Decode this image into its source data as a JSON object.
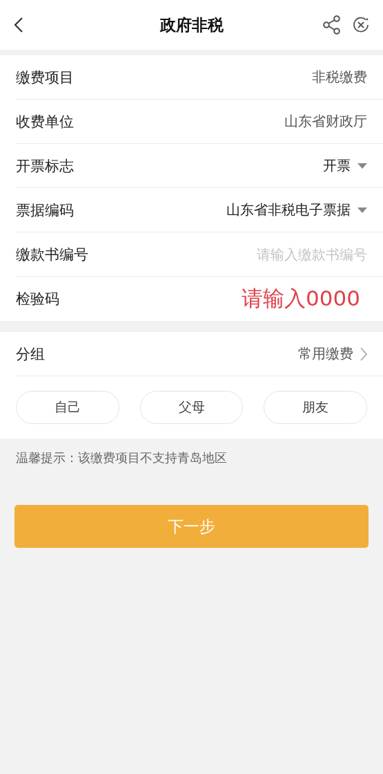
{
  "nav": {
    "title": "政府非税"
  },
  "fields": [
    {
      "kind": "value",
      "label": "缴费项目",
      "value": "非税缴费"
    },
    {
      "kind": "value",
      "label": "收费单位",
      "value": "山东省财政厅"
    },
    {
      "kind": "dropdown",
      "label": "开票标志",
      "value": "开票"
    },
    {
      "kind": "dropdown",
      "label": "票据编码",
      "value": "山东省非税电子票据"
    },
    {
      "kind": "input",
      "label": "缴款书编号",
      "placeholder": "请输入缴款书编号"
    },
    {
      "kind": "annotated",
      "label": "检验码",
      "annotation": "请输入0000"
    }
  ],
  "group": {
    "label": "分组",
    "value": "常用缴费"
  },
  "chips": [
    {
      "label": "自己"
    },
    {
      "label": "父母"
    },
    {
      "label": "朋友"
    }
  ],
  "tip": "温馨提示：该缴费项目不支持青岛地区",
  "next_button": "下一步"
}
